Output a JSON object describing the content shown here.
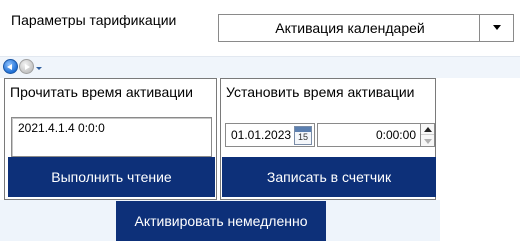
{
  "header": {
    "tariff_label": "Параметры тарификации",
    "tariff_select_value": "Активация календарей"
  },
  "read_panel": {
    "title": "Прочитать время активации",
    "readout_value": "2021.4.1.4 0:0:0",
    "button_label": "Выполнить чтение"
  },
  "write_panel": {
    "title": "Установить время активации",
    "date_value": "01.01.2023",
    "calendar_icon_day": "15",
    "time_value": "0:00:00",
    "button_label": "Записать в счетчик"
  },
  "activate_button_label": "Активировать немедленно",
  "colors": {
    "button_bg": "#0d3079",
    "nav_bar_bg": "#f0f5fb",
    "bottom_band_bg": "#eef4fb"
  },
  "icons": {
    "nav_back": "back-arrow-icon",
    "nav_forward": "forward-arrow-icon",
    "nav_history": "history-dropdown-icon",
    "select_arrow": "chevron-down-icon",
    "calendar": "calendar-icon",
    "spin_up": "spin-up-icon",
    "spin_down": "spin-down-icon"
  }
}
